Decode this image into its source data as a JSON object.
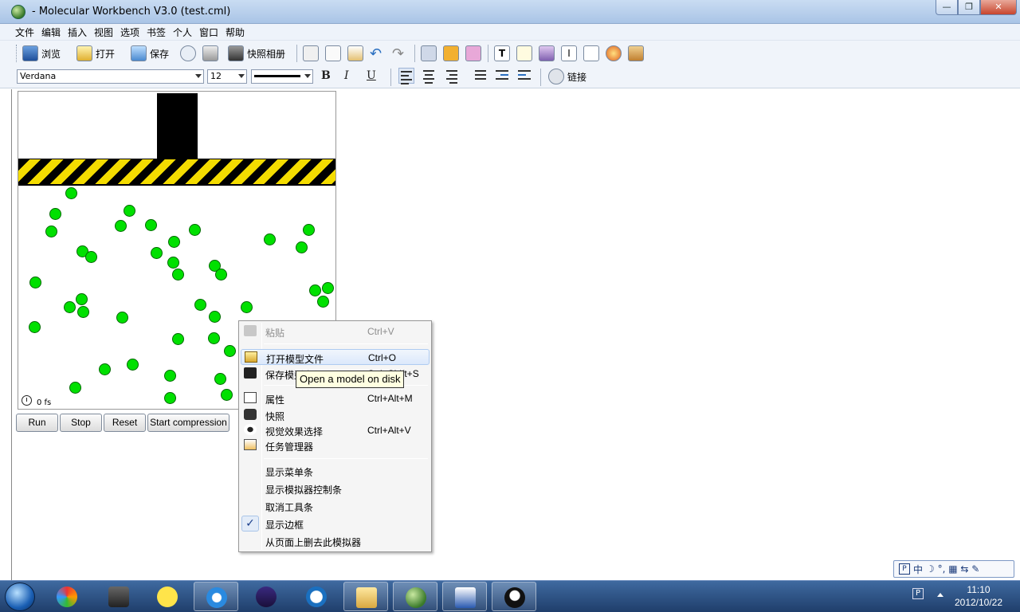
{
  "window": {
    "title": "- Molecular Workbench V3.0 (test.cml)",
    "buttons": {
      "minimize": "—",
      "maximize": "❐",
      "close": "✕"
    }
  },
  "menubar": [
    "文件",
    "编辑",
    "插入",
    "视图",
    "选项",
    "书签",
    "个人",
    "窗口",
    "帮助"
  ],
  "toolbar": {
    "browse": "浏览",
    "open": "打开",
    "save": "保存",
    "snapshot_album": "快照相册",
    "link": "链接",
    "font": "Verdana",
    "size": "12",
    "bold": "B",
    "italic": "I",
    "underline": "U"
  },
  "simulation": {
    "time_readout": "0 fs",
    "buttons": {
      "run": "Run",
      "stop": "Stop",
      "reset": "Reset",
      "compress": "Start compression"
    }
  },
  "context_menu": {
    "items": [
      {
        "label": "粘贴",
        "shortcut": "Ctrl+V",
        "enabled": false
      },
      {
        "label": "打开模型文件",
        "shortcut": "Ctrl+O",
        "enabled": true,
        "highlighted": true
      },
      {
        "label": "保存模型文件",
        "shortcut": "Ctrl+Shift+S",
        "enabled": true
      },
      {
        "label": "属性",
        "shortcut": "Ctrl+Alt+M",
        "enabled": true
      },
      {
        "label": "快照",
        "shortcut": "",
        "enabled": true
      },
      {
        "label": "视觉效果选择",
        "shortcut": "Ctrl+Alt+V",
        "enabled": true
      },
      {
        "label": "任务管理器",
        "shortcut": "",
        "enabled": true
      },
      {
        "label": "显示菜单条",
        "shortcut": "",
        "enabled": true
      },
      {
        "label": "显示模拟器控制条",
        "shortcut": "",
        "enabled": true
      },
      {
        "label": "取消工具条",
        "shortcut": "",
        "enabled": true
      },
      {
        "label": "显示边框",
        "shortcut": "",
        "enabled": true,
        "checked": true
      },
      {
        "label": "从页面上删去此模拟器",
        "shortcut": "",
        "enabled": true
      }
    ],
    "check_mark": "✓"
  },
  "tooltip": "Open a model on disk",
  "ime_bar": {
    "mode": "中",
    "symbols": "☽ °, ▦ ⇆ ✎"
  },
  "taskbar": {
    "ime_indicator": "P",
    "time": "11:10",
    "date": "2012/10/22"
  },
  "colors": {
    "atom_fill": "#00e000",
    "hazard_stripe": "#f4dc00",
    "taskbar": "#2a4f82"
  }
}
